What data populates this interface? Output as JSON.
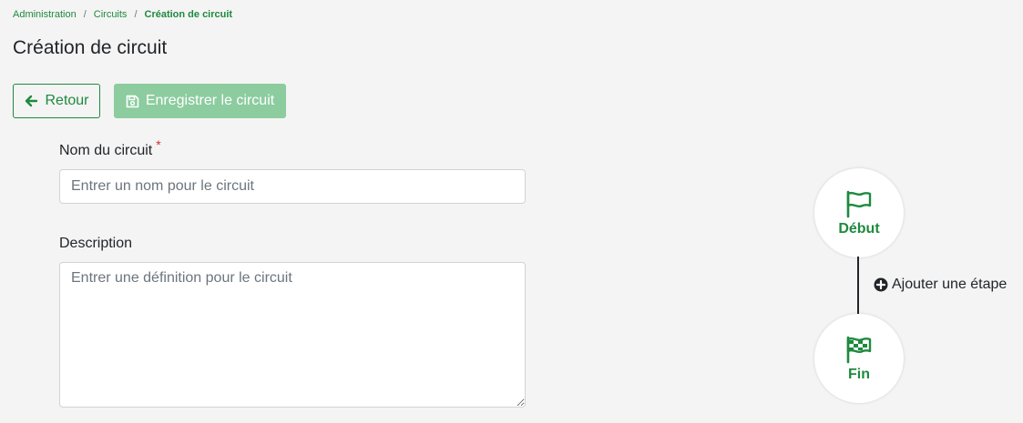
{
  "breadcrumb": {
    "items": [
      "Administration",
      "Circuits",
      "Création de circuit"
    ],
    "separator": "/"
  },
  "page": {
    "title": "Création de circuit"
  },
  "toolbar": {
    "back_label": "Retour",
    "save_label": "Enregistrer le circuit",
    "save_enabled": false
  },
  "form": {
    "name": {
      "label": "Nom du circuit",
      "required_marker": "*",
      "value": "",
      "placeholder": "Entrer un nom pour le circuit"
    },
    "description": {
      "label": "Description",
      "value": "",
      "placeholder": "Entrer une définition pour le circuit"
    }
  },
  "workflow": {
    "start_label": "Début",
    "end_label": "Fin",
    "add_step_label": "Ajouter une étape",
    "start_icon": "flag-icon",
    "end_icon": "checkered-flag-icon",
    "add_icon": "plus-circle-icon"
  },
  "colors": {
    "accent": "#1e8a3e",
    "accent_disabled": "#8ccc9f",
    "required": "#d32f2f",
    "background": "#f4f4f4"
  }
}
